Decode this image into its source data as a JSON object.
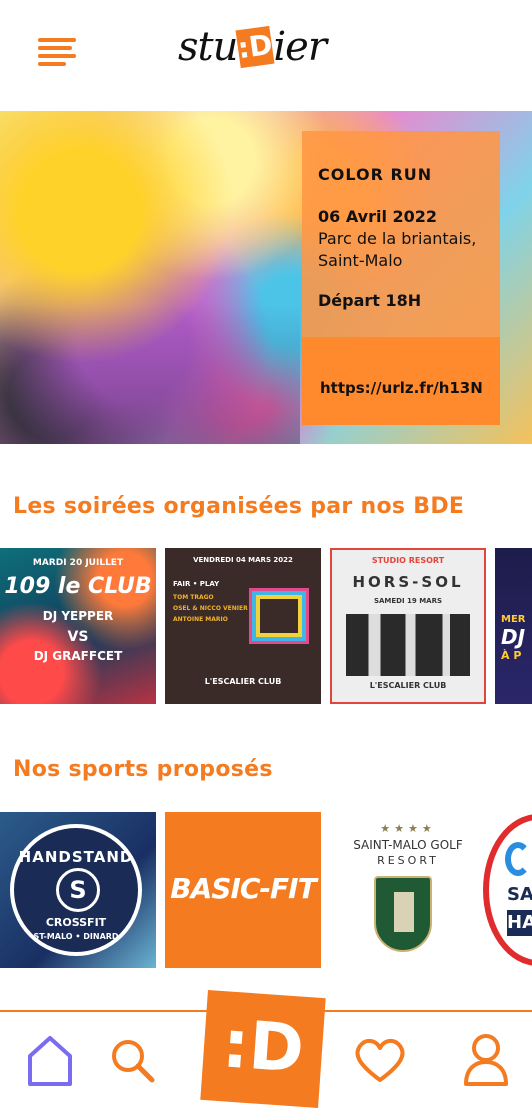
{
  "header": {
    "logo_left": "stu",
    "logo_mark": ":D",
    "logo_right": "ier"
  },
  "hero": {
    "title": "COLOR RUN",
    "date": "06 Avril 2022",
    "place": "Parc de la briantais, Saint-Malo",
    "time": "Départ 18H",
    "link": "https://urlz.fr/h13N"
  },
  "parties": {
    "title": "Les soirées organisées par nos BDE",
    "items": [
      {
        "top": "MARDI 20 JUILLET",
        "name": "109 le CLUB",
        "line1": "DJ YEPPER",
        "vs": "VS",
        "line2": "DJ GRAFFCET"
      },
      {
        "top": "VENDREDI 04 MARS 2022",
        "name": "FAIR • PLAY",
        "line1": "TOM TRAGO",
        "line2": "OSEL & NICCO VENIER",
        "line3": "ANTOINE MARIO",
        "footer": "L'ESCALIER CLUB"
      },
      {
        "top": "STUDIO RESORT",
        "name": "HORS-SOL",
        "date": "SAMEDI 19 MARS",
        "footer": "L'ESCALIER CLUB"
      },
      {
        "top": "MER",
        "name": "DJ",
        "line1": "À P"
      }
    ]
  },
  "sports": {
    "title": "Nos sports proposés",
    "items": [
      {
        "name": "HANDSTAND",
        "sub": "CROSSFIT",
        "place": "ST-MALO • DINARD",
        "mark": "S"
      },
      {
        "name": "BASIC-FIT"
      },
      {
        "stars": "★★★★",
        "name": "SAINT-MALO GOLF",
        "sub": "RESORT"
      },
      {
        "name": "SA",
        "sub": "HA"
      }
    ]
  },
  "nav": {
    "items": [
      "home",
      "search",
      "logo",
      "favorites",
      "profile"
    ],
    "logo_label": ":D"
  },
  "colors": {
    "accent": "#f47b20",
    "nav_active": "#7a6cf0"
  }
}
